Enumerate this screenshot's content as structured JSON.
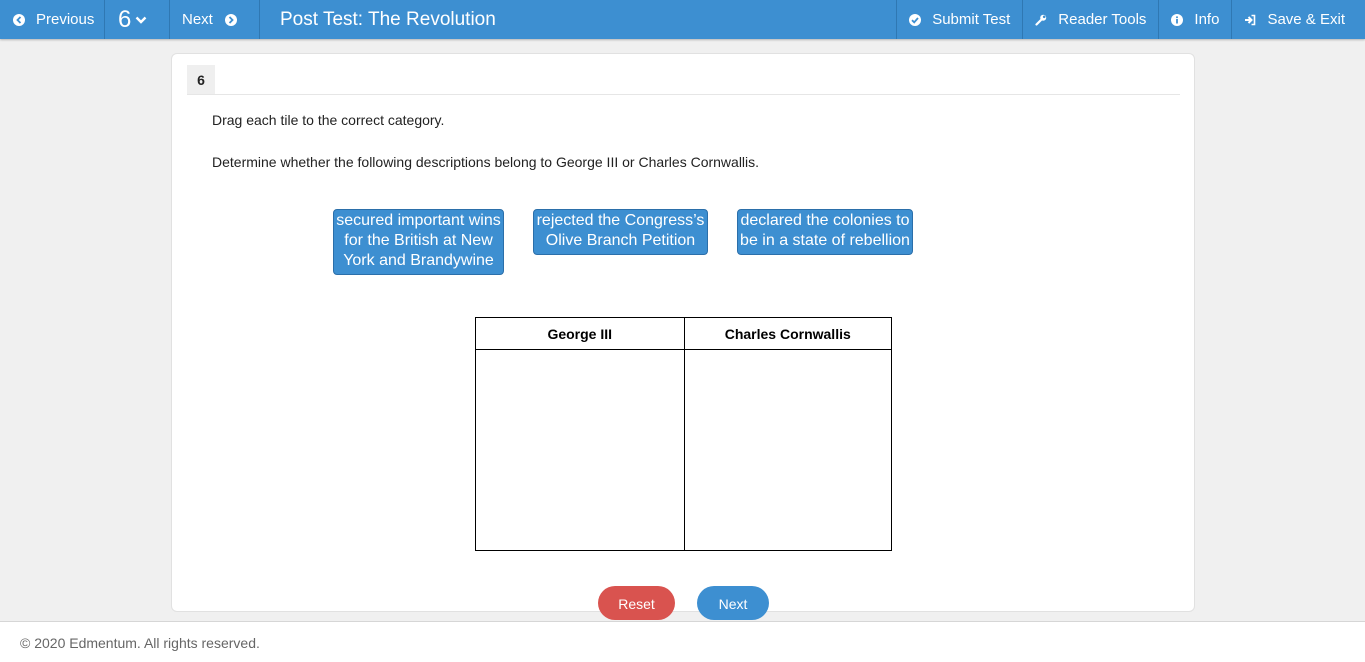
{
  "toolbar": {
    "previous_label": "Previous",
    "question_number": "6",
    "next_label": "Next",
    "title": "Post Test: The Revolution",
    "submit_label": "Submit Test",
    "reader_tools_label": "Reader Tools",
    "info_label": "Info",
    "save_exit_label": "Save & Exit"
  },
  "question": {
    "number": "6",
    "instruction": "Drag each tile to the correct category.",
    "prompt": "Determine whether the following descriptions belong to George III or Charles Cornwallis.",
    "tiles": [
      "secured important wins for the British at New York and Brandywine",
      "rejected the Congress’s Olive Branch Petition",
      "declared the colonies to be in a state of rebellion"
    ],
    "categories": [
      "George III",
      "Charles Cornwallis"
    ],
    "reset_label": "Reset",
    "next_label": "Next"
  },
  "footer": {
    "copyright": "© 2020 Edmentum. All rights reserved."
  },
  "colors": {
    "toolbar": "#3d8fd1",
    "tile": "#3d8fd1",
    "reset": "#d9534f",
    "next": "#3d8fd1"
  }
}
